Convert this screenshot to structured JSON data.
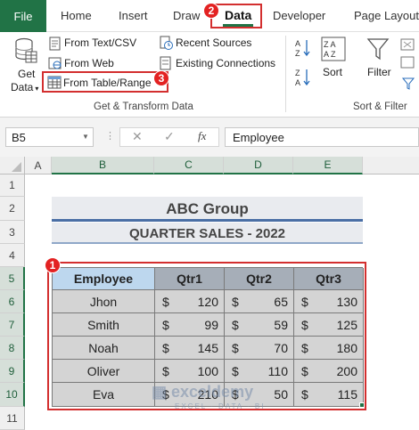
{
  "ribbon_tabs": {
    "file": "File",
    "home": "Home",
    "insert": "Insert",
    "draw": "Draw",
    "data": "Data",
    "developer": "Developer",
    "page_layout": "Page Layout"
  },
  "get_transform": {
    "get_data_line1": "Get",
    "get_data_line2": "Data",
    "from_text_csv": "From Text/CSV",
    "from_web": "From Web",
    "from_table_range": "From Table/Range",
    "recent_sources": "Recent Sources",
    "existing_connections": "Existing Connections",
    "group_label": "Get & Transform Data"
  },
  "sort_filter": {
    "az": "A Z",
    "za": "Z A",
    "sort": "Sort",
    "filter": "Filter",
    "group_label": "Sort & Filter"
  },
  "formula_bar": {
    "name_box": "B5",
    "fx": "fx",
    "content": "Employee"
  },
  "badges": [
    "1",
    "2",
    "3"
  ],
  "columns": [
    "A",
    "B",
    "C",
    "D",
    "E"
  ],
  "rows": [
    "1",
    "2",
    "3",
    "4",
    "5",
    "6",
    "7",
    "8",
    "9",
    "10",
    "11"
  ],
  "sheet": {
    "title": "ABC Group",
    "subtitle": "QUARTER SALES - 2022",
    "headers": [
      "Employee",
      "Qtr1",
      "Qtr2",
      "Qtr3"
    ],
    "currency": "$",
    "data": [
      {
        "name": "Jhon",
        "q1": "120",
        "q2": "65",
        "q3": "130"
      },
      {
        "name": "Smith",
        "q1": "99",
        "q2": "59",
        "q3": "125"
      },
      {
        "name": "Noah",
        "q1": "145",
        "q2": "70",
        "q3": "180"
      },
      {
        "name": "Oliver",
        "q1": "100",
        "q2": "110",
        "q3": "200"
      },
      {
        "name": "Eva",
        "q1": "210",
        "q2": "50",
        "q3": "115"
      }
    ]
  },
  "watermark": {
    "brand": "exceldemy",
    "tagline": "EXCEL · DATA · BI"
  },
  "colors": {
    "excel_green": "#217346",
    "highlight_red": "#d32f2f",
    "header_blue": "#bdd7ee",
    "header_gray": "#a6aeb8",
    "data_gray": "#d4d4d4"
  }
}
